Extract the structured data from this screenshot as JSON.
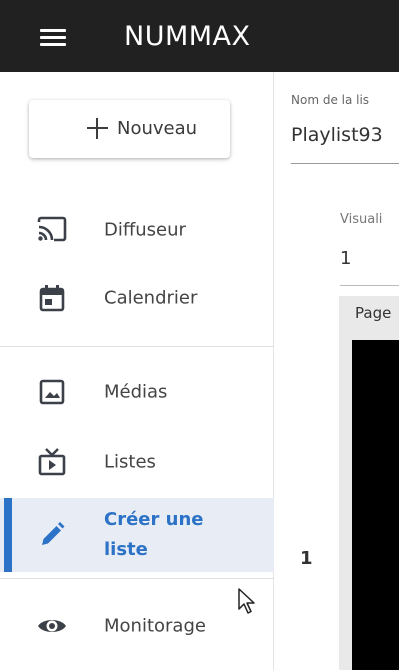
{
  "topbar": {
    "menu_icon": "hamburger-menu-icon",
    "brand": "NUMMAX"
  },
  "sidebar": {
    "new_button": {
      "icon": "plus-icon",
      "label": "Nouveau"
    },
    "items": [
      {
        "id": "diffuseur",
        "label": "Diffuseur",
        "icon": "cast-icon"
      },
      {
        "id": "calendrier",
        "label": "Calendrier",
        "icon": "calendar-icon"
      },
      {
        "id": "medias",
        "label": "Médias",
        "icon": "image-icon"
      },
      {
        "id": "listes",
        "label": "Listes",
        "icon": "playlist-tv-icon"
      },
      {
        "id": "creer-une-liste",
        "label_line1": "Créer une",
        "label_line2": "liste",
        "icon": "pencil-icon",
        "active": true
      },
      {
        "id": "monitorage",
        "label": "Monitorage",
        "icon": "eye-icon"
      }
    ]
  },
  "main": {
    "name_label": "Nom de la lis",
    "name_value": "Playlist93",
    "visualisation_label": "Visuali",
    "visualisation_value": "1",
    "row_number": "1",
    "page_label": "Page"
  },
  "colors": {
    "topbar_bg": "#212121",
    "accent": "#2c72c6",
    "active_bg": "#e8edf5",
    "icon": "#3c4048"
  }
}
